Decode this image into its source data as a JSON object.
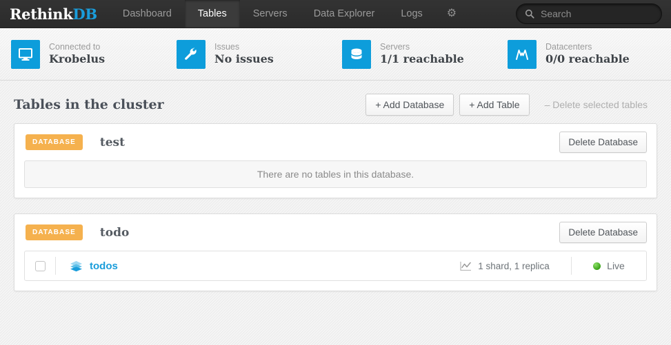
{
  "navbar": {
    "logo_main": "Rethink",
    "logo_accent": "DB",
    "links": [
      {
        "label": "Dashboard",
        "active": false
      },
      {
        "label": "Tables",
        "active": true
      },
      {
        "label": "Servers",
        "active": false
      },
      {
        "label": "Data Explorer",
        "active": false
      },
      {
        "label": "Logs",
        "active": false
      }
    ],
    "settings_icon": "gear-icon",
    "search": {
      "icon": "search-icon",
      "placeholder": "Search",
      "value": ""
    }
  },
  "statusbar": {
    "items": [
      {
        "icon": "monitor-icon",
        "label": "Connected to",
        "value": "Krobelus"
      },
      {
        "icon": "wrench-icon",
        "label": "Issues",
        "value": "No issues"
      },
      {
        "icon": "database-icon",
        "label": "Servers",
        "value": "1/1 reachable"
      },
      {
        "icon": "datacenter-icon",
        "label": "Datacenters",
        "value": "0/0 reachable"
      }
    ]
  },
  "main": {
    "title": "Tables in the cluster",
    "actions": [
      {
        "label": "+ Add Database",
        "disabled": false
      },
      {
        "label": "+ Add Table",
        "disabled": false
      },
      {
        "label": "– Delete selected tables",
        "disabled": true
      }
    ],
    "databases": [
      {
        "badge": "DATABASE",
        "name": "test",
        "delete_label": "Delete Database",
        "empty_message": "There are no tables in this database.",
        "tables": []
      },
      {
        "badge": "DATABASE",
        "name": "todo",
        "delete_label": "Delete Database",
        "empty_message": "",
        "tables": [
          {
            "name": "todos",
            "shards": "1 shard, 1 replica",
            "status": "Live",
            "checked": false
          }
        ]
      }
    ]
  },
  "colors": {
    "accent_blue": "#1a9ddb",
    "icon_blue": "#0d9ddb",
    "badge_orange": "#f5b14e",
    "status_green": "#3aa319",
    "navbar_dark": "#2e2e2e"
  }
}
